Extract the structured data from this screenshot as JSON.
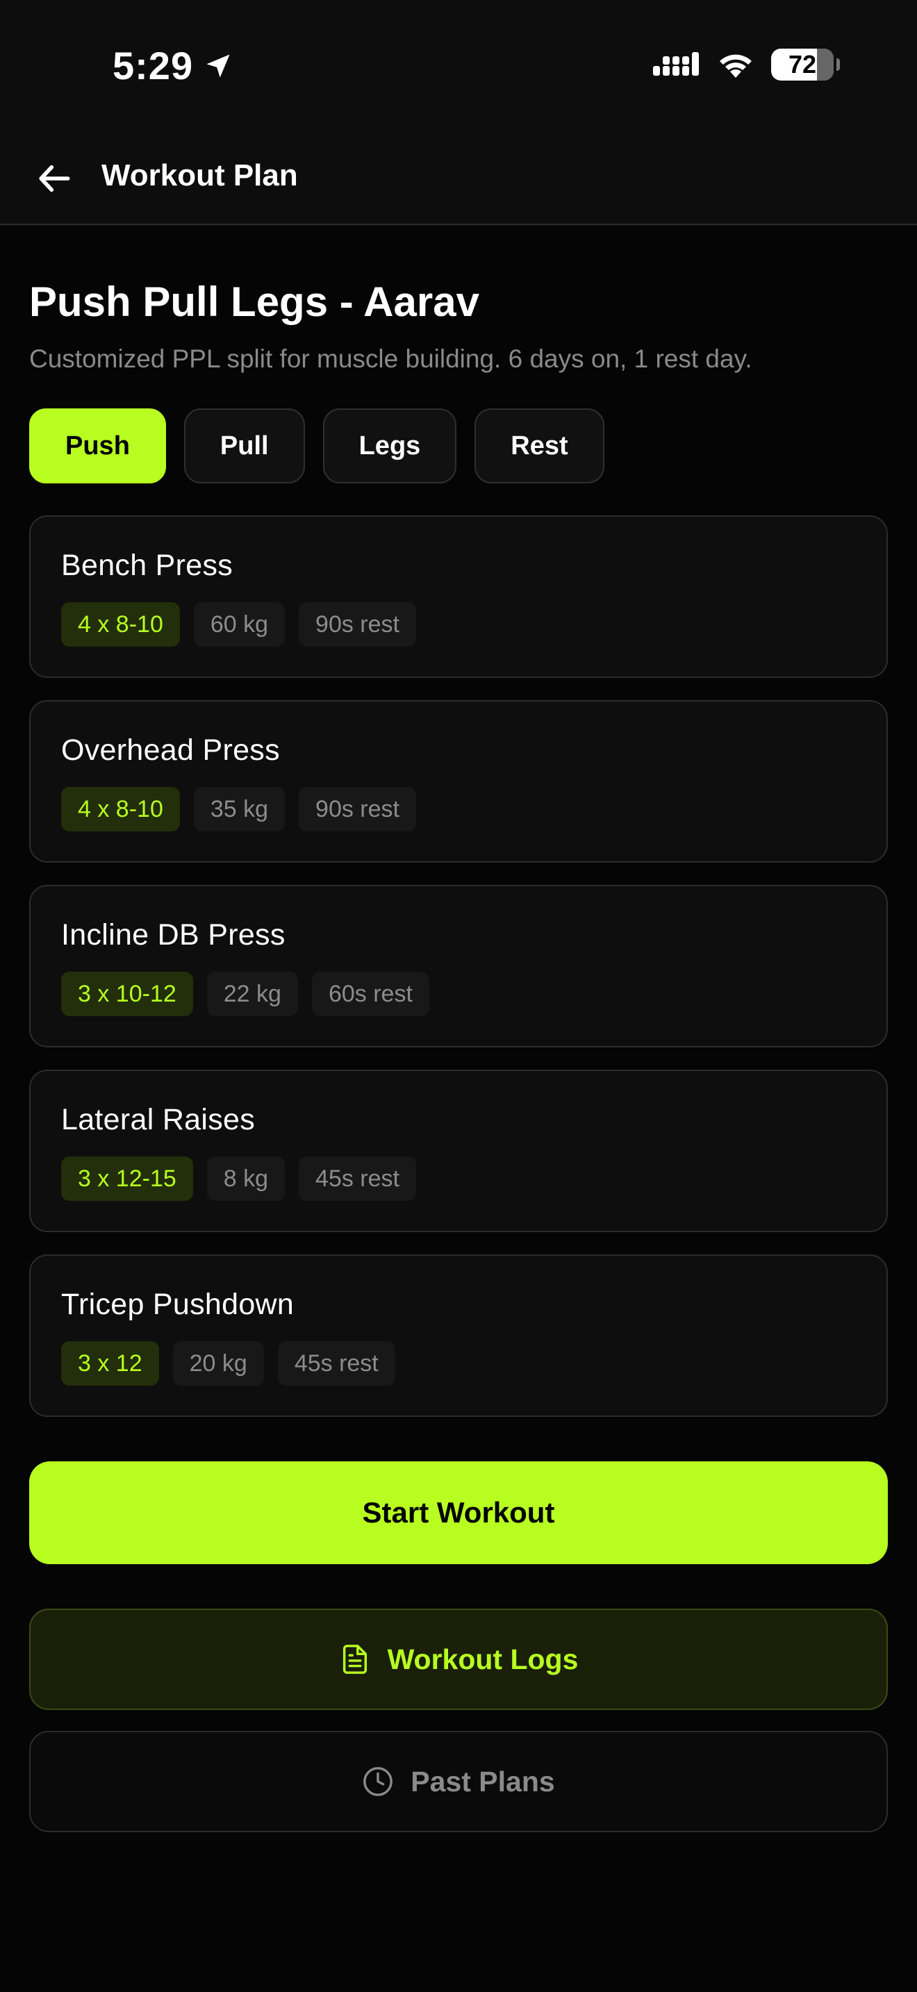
{
  "status_bar": {
    "time": "5:29",
    "battery": "72"
  },
  "nav": {
    "title": "Workout Plan"
  },
  "plan": {
    "title": "Push Pull Legs - Aarav",
    "description": "Customized PPL split for muscle building. 6 days on, 1 rest day."
  },
  "tabs": [
    {
      "label": "Push",
      "active": true
    },
    {
      "label": "Pull",
      "active": false
    },
    {
      "label": "Legs",
      "active": false
    },
    {
      "label": "Rest",
      "active": false
    }
  ],
  "exercises": [
    {
      "name": "Bench Press",
      "sets": "4 x 8-10",
      "weight": "60 kg",
      "rest": "90s rest"
    },
    {
      "name": "Overhead Press",
      "sets": "4 x 8-10",
      "weight": "35 kg",
      "rest": "90s rest"
    },
    {
      "name": "Incline DB Press",
      "sets": "3 x 10-12",
      "weight": "22 kg",
      "rest": "60s rest"
    },
    {
      "name": "Lateral Raises",
      "sets": "3 x 12-15",
      "weight": "8 kg",
      "rest": "45s rest"
    },
    {
      "name": "Tricep Pushdown",
      "sets": "3 x 12",
      "weight": "20 kg",
      "rest": "45s rest"
    }
  ],
  "actions": {
    "start_workout": "Start Workout",
    "workout_logs": "Workout Logs",
    "past_plans": "Past Plans"
  },
  "colors": {
    "accent": "#b8ff21",
    "background": "#050505",
    "card": "#0e0e0e",
    "muted_text": "#8a8a8a"
  },
  "icons": {
    "back": "arrow-left-icon",
    "location": "location-arrow-icon",
    "signal": "cellular-signal-icon",
    "wifi": "wifi-icon",
    "battery": "battery-icon",
    "logs": "document-icon",
    "past": "clock-icon"
  }
}
